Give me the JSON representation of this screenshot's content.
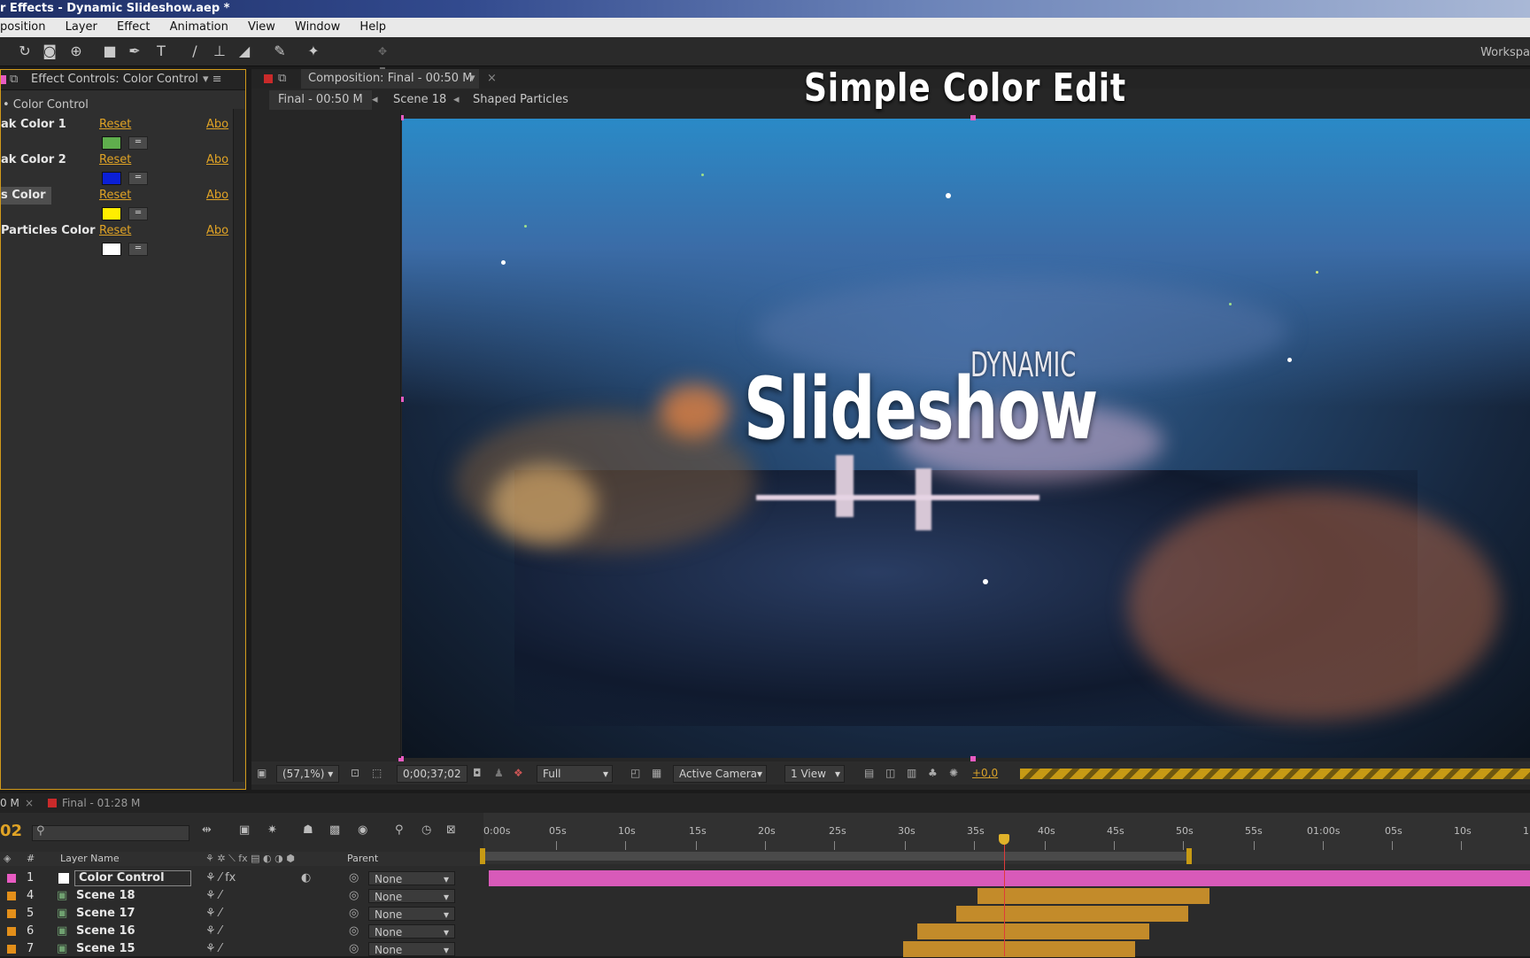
{
  "window": {
    "title": "r Effects - Dynamic Slideshow.aep *"
  },
  "menu": [
    "position",
    "Layer",
    "Effect",
    "Animation",
    "View",
    "Window",
    "Help"
  ],
  "toolbar": {
    "workspace_label": "Workspa"
  },
  "effect_controls": {
    "tab_label": "Effect Controls: Color Control",
    "effect_name": "• Color Control",
    "reset_label": "Reset",
    "about_label": "Abo",
    "params": [
      {
        "name": "ak Color 1",
        "swatch": "#5fae4d"
      },
      {
        "name": "ak Color 2",
        "swatch": "#0b1fd6"
      },
      {
        "name": "s Color",
        "swatch": "#ffee00"
      },
      {
        "name": "Particles Color",
        "swatch": "#ffffff"
      }
    ]
  },
  "composition": {
    "tab_label": "Composition: Final - 00:50 M",
    "breadcrumb": [
      "Final - 00:50 M",
      "Scene 18",
      "Shaped Particles"
    ],
    "overlay_title": "Simple Color Edit",
    "viewer_subtitle": "DYNAMIC",
    "viewer_title": "Slideshow",
    "bottom_bar": {
      "zoom": "(57,1%)",
      "timecode": "0;00;37;02",
      "resolution": "Full",
      "camera": "Active Camera",
      "views": "1 View",
      "exposure": "+0,0"
    }
  },
  "timeline": {
    "tabs": [
      "0 M",
      "Final - 01:28 M"
    ],
    "current_frame_fragment": "02",
    "column_headers": {
      "num": "#",
      "layer_name": "Layer Name",
      "parent": "Parent"
    },
    "ruler_labels": [
      "0:00s",
      "05s",
      "10s",
      "15s",
      "20s",
      "25s",
      "30s",
      "35s",
      "40s",
      "45s",
      "50s",
      "55s",
      "01:00s",
      "05s",
      "10s",
      "1"
    ],
    "layers": [
      {
        "num": "1",
        "name": "Color Control",
        "parent": "None",
        "color": "#e85bc2",
        "bar_color": "#d85ab9"
      },
      {
        "num": "4",
        "name": "Scene 18",
        "parent": "None",
        "color": "#e38f1a",
        "bar_color": "#c38b2a"
      },
      {
        "num": "5",
        "name": "Scene 17",
        "parent": "None",
        "color": "#e38f1a",
        "bar_color": "#c38b2a"
      },
      {
        "num": "6",
        "name": "Scene 16",
        "parent": "None",
        "color": "#e38f1a",
        "bar_color": "#c38b2a"
      },
      {
        "num": "7",
        "name": "Scene 15",
        "parent": "None",
        "color": "#e38f1a",
        "bar_color": "#c38b2a"
      }
    ]
  }
}
